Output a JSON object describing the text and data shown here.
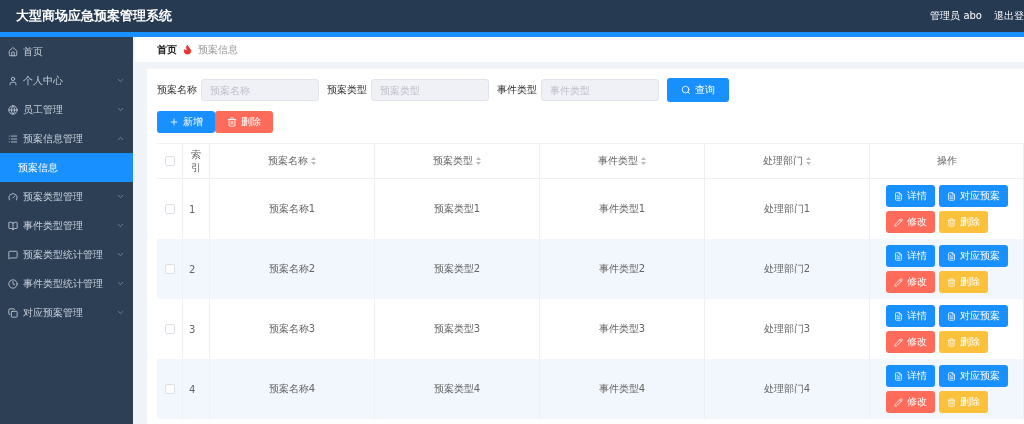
{
  "header": {
    "title": "大型商场应急预案管理系统",
    "user": "管理员 abo",
    "logout": "退出登"
  },
  "sidebar": {
    "items": [
      {
        "label": "首页",
        "kind": "link"
      },
      {
        "label": "个人中心",
        "kind": "group",
        "expanded": false
      },
      {
        "label": "员工管理",
        "kind": "group",
        "expanded": false
      },
      {
        "label": "预案信息管理",
        "kind": "group",
        "expanded": true,
        "children": [
          {
            "label": "预案信息",
            "selected": true
          }
        ]
      },
      {
        "label": "预案类型管理",
        "kind": "group",
        "expanded": false
      },
      {
        "label": "事件类型管理",
        "kind": "group",
        "expanded": false
      },
      {
        "label": "预案类型统计管理",
        "kind": "group",
        "expanded": false
      },
      {
        "label": "事件类型统计管理",
        "kind": "group",
        "expanded": false
      },
      {
        "label": "对应预案管理",
        "kind": "group",
        "expanded": false
      }
    ]
  },
  "breadcrumb": [
    {
      "label": "首页",
      "current": false
    },
    {
      "label": "预案信息",
      "current": true
    }
  ],
  "filters": [
    {
      "label": "预案名称",
      "placeholder": "预案名称"
    },
    {
      "label": "预案类型",
      "placeholder": "预案类型"
    },
    {
      "label": "事件类型",
      "placeholder": "事件类型"
    }
  ],
  "search_button": "查询",
  "actions": [
    {
      "label": "新增",
      "kind": "add"
    },
    {
      "label": "删除",
      "kind": "delete"
    }
  ],
  "table": {
    "header_checked": false,
    "columns": [
      {
        "label": "索引",
        "sortable": false
      },
      {
        "label": "预案名称",
        "sortable": true
      },
      {
        "label": "预案类型",
        "sortable": true
      },
      {
        "label": "事件类型",
        "sortable": true
      },
      {
        "label": "处理部门",
        "sortable": true
      },
      {
        "label": "操作",
        "sortable": false
      }
    ],
    "rows": [
      {
        "checked": false,
        "cells": [
          "1",
          "预案名称1",
          "预案类型1",
          "事件类型1",
          "处理部门1"
        ],
        "actions": [
          {
            "label": "详情",
            "kind": "detail"
          },
          {
            "label": "对应预案",
            "kind": "detail"
          },
          {
            "label": "修改",
            "kind": "edit"
          },
          {
            "label": "删除",
            "kind": "remove"
          }
        ]
      },
      {
        "checked": false,
        "cells": [
          "2",
          "预案名称2",
          "预案类型2",
          "事件类型2",
          "处理部门2"
        ],
        "actions": [
          {
            "label": "详情",
            "kind": "detail"
          },
          {
            "label": "对应预案",
            "kind": "detail"
          },
          {
            "label": "修改",
            "kind": "edit"
          },
          {
            "label": "删除",
            "kind": "remove"
          }
        ]
      },
      {
        "checked": false,
        "cells": [
          "3",
          "预案名称3",
          "预案类型3",
          "事件类型3",
          "处理部门3"
        ],
        "actions": [
          {
            "label": "详情",
            "kind": "detail"
          },
          {
            "label": "对应预案",
            "kind": "detail"
          },
          {
            "label": "修改",
            "kind": "edit"
          },
          {
            "label": "删除",
            "kind": "remove"
          }
        ]
      },
      {
        "checked": false,
        "cells": [
          "4",
          "预案名称4",
          "预案类型4",
          "事件类型4",
          "处理部门4"
        ],
        "actions": [
          {
            "label": "详情",
            "kind": "detail"
          },
          {
            "label": "对应预案",
            "kind": "detail"
          },
          {
            "label": "修改",
            "kind": "edit"
          },
          {
            "label": "删除",
            "kind": "remove"
          }
        ]
      }
    ]
  }
}
